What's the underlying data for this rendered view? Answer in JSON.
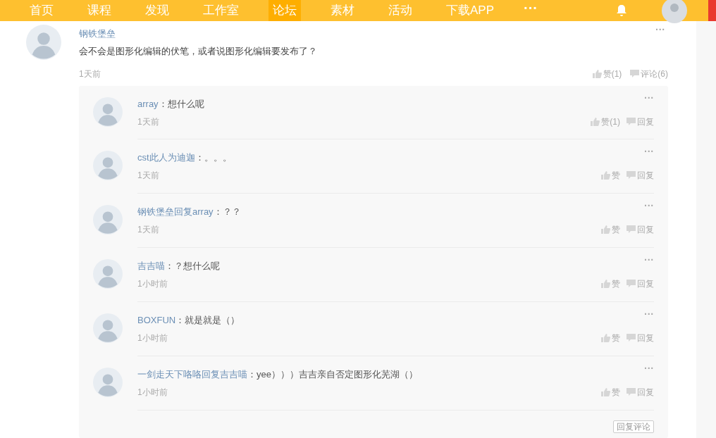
{
  "nav": {
    "items": [
      {
        "label": "首页",
        "selected": false
      },
      {
        "label": "课程",
        "selected": false
      },
      {
        "label": "发现",
        "selected": false
      },
      {
        "label": "工作室",
        "selected": false
      },
      {
        "label": "论坛",
        "selected": true
      },
      {
        "label": "素材",
        "selected": false
      },
      {
        "label": "活动",
        "selected": false
      },
      {
        "label": "下载APP",
        "selected": false
      }
    ],
    "more": "···"
  },
  "post": {
    "author": "钢铁堡垒",
    "text": "会不会是图形化编辑的伏笔，或者说图形化编辑要发布了？",
    "time": "1天前",
    "more": "···",
    "like": "赞(1)",
    "comment": "评论(6)"
  },
  "replies": [
    {
      "speaker": "array",
      "text": "：想什么呢",
      "time": "1天前",
      "like": "赞(1)",
      "reply": "回复",
      "more": "···"
    },
    {
      "speaker": "cst此人为迪迦",
      "text": "：。。。",
      "time": "1天前",
      "like": "赞",
      "reply": "回复",
      "more": "···"
    },
    {
      "speaker": "钢铁堡垒回复array",
      "text": "：？？",
      "time": "1天前",
      "like": "赞",
      "reply": "回复",
      "more": "···"
    },
    {
      "speaker": "吉吉喵",
      "text": "：？想什么呢",
      "time": "1小时前",
      "like": "赞",
      "reply": "回复",
      "more": "···"
    },
    {
      "speaker": "BOXFUN",
      "text": "：就是就是（）",
      "time": "1小时前",
      "like": "赞",
      "reply": "回复",
      "more": "···"
    },
    {
      "speaker": "一剑走天下咯咯回复吉吉喵",
      "text": "：yee）））吉吉亲自否定图形化芜湖（）",
      "time": "1小时前",
      "like": "赞",
      "reply": "回复",
      "more": "···"
    }
  ],
  "reply_button": "回复评论"
}
